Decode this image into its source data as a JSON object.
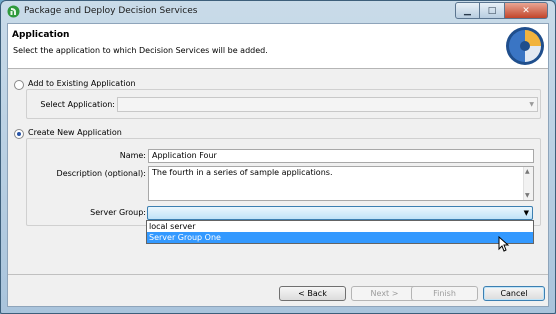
{
  "window": {
    "title": "Package and Deploy Decision Services",
    "controls": {
      "minimize": "minimize",
      "maximize": "maximize",
      "close": "close"
    }
  },
  "header": {
    "title": "Application",
    "description": "Select the application to which Decision Services will be added."
  },
  "existing_app": {
    "radio_label": "Add to Existing Application",
    "select_label": "Select Application:",
    "select_value": "",
    "checked": false
  },
  "new_app": {
    "radio_label": "Create New Application",
    "checked": true,
    "name_label": "Name:",
    "name_value": "Application Four",
    "description_label": "Description (optional):",
    "description_value": "The fourth in a series of sample applications.",
    "server_group_label": "Server Group:",
    "server_group_value": "",
    "server_group_options": [
      "local server",
      "Server Group One"
    ],
    "server_group_highlighted": "Server Group One"
  },
  "buttons": {
    "back": "< Back",
    "next": "Next >",
    "finish": "Finish",
    "cancel": "Cancel"
  },
  "icons": {
    "app": "green-deploy-icon",
    "logo": "decision-services-pie-logo",
    "cursor": "mouse-pointer-icon"
  },
  "colors": {
    "selection": "#3399ff",
    "focus_border": "#3c7fb1",
    "radio_dot": "#2a56a8"
  }
}
